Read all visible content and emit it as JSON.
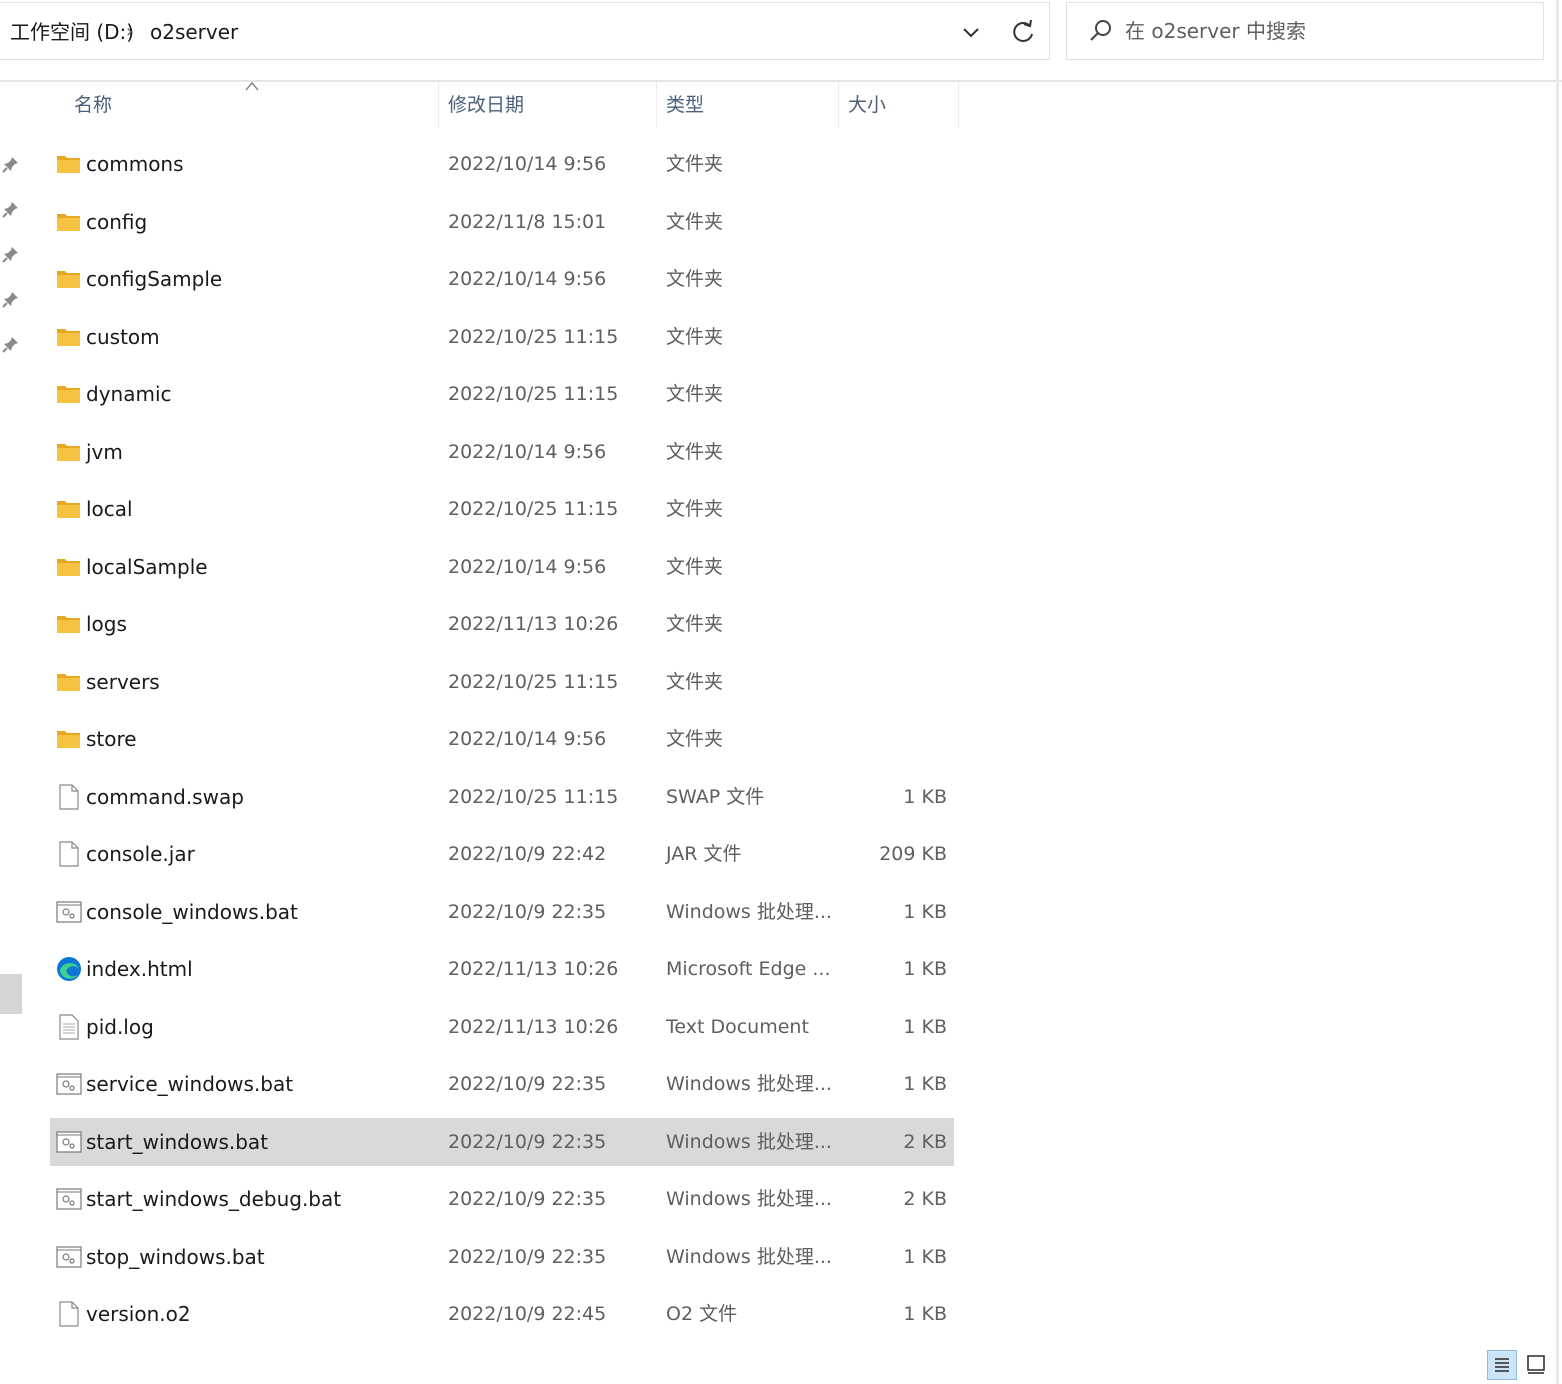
{
  "breadcrumb": {
    "drive": "工作空间 (D:)",
    "separator": "›",
    "folder": "o2server"
  },
  "search": {
    "placeholder": "在 o2server 中搜索"
  },
  "columns": {
    "name": "名称",
    "date": "修改日期",
    "type": "类型",
    "size": "大小"
  },
  "files": [
    {
      "name": "commons",
      "date": "2022/10/14 9:56",
      "type": "文件夹",
      "size": "",
      "icon": "folder-icon"
    },
    {
      "name": "config",
      "date": "2022/11/8 15:01",
      "type": "文件夹",
      "size": "",
      "icon": "folder-icon"
    },
    {
      "name": "configSample",
      "date": "2022/10/14 9:56",
      "type": "文件夹",
      "size": "",
      "icon": "folder-icon"
    },
    {
      "name": "custom",
      "date": "2022/10/25 11:15",
      "type": "文件夹",
      "size": "",
      "icon": "folder-icon"
    },
    {
      "name": "dynamic",
      "date": "2022/10/25 11:15",
      "type": "文件夹",
      "size": "",
      "icon": "folder-icon"
    },
    {
      "name": "jvm",
      "date": "2022/10/14 9:56",
      "type": "文件夹",
      "size": "",
      "icon": "folder-icon"
    },
    {
      "name": "local",
      "date": "2022/10/25 11:15",
      "type": "文件夹",
      "size": "",
      "icon": "folder-icon"
    },
    {
      "name": "localSample",
      "date": "2022/10/14 9:56",
      "type": "文件夹",
      "size": "",
      "icon": "folder-icon"
    },
    {
      "name": "logs",
      "date": "2022/11/13 10:26",
      "type": "文件夹",
      "size": "",
      "icon": "folder-icon"
    },
    {
      "name": "servers",
      "date": "2022/10/25 11:15",
      "type": "文件夹",
      "size": "",
      "icon": "folder-icon"
    },
    {
      "name": "store",
      "date": "2022/10/14 9:56",
      "type": "文件夹",
      "size": "",
      "icon": "folder-icon"
    },
    {
      "name": "command.swap",
      "date": "2022/10/25 11:15",
      "type": "SWAP 文件",
      "size": "1 KB",
      "icon": "file-icon"
    },
    {
      "name": "console.jar",
      "date": "2022/10/9 22:42",
      "type": "JAR 文件",
      "size": "209 KB",
      "icon": "file-icon"
    },
    {
      "name": "console_windows.bat",
      "date": "2022/10/9 22:35",
      "type": "Windows 批处理...",
      "size": "1 KB",
      "icon": "batch-file-icon"
    },
    {
      "name": "index.html",
      "date": "2022/11/13 10:26",
      "type": "Microsoft Edge ...",
      "size": "1 KB",
      "icon": "edge-icon"
    },
    {
      "name": "pid.log",
      "date": "2022/11/13 10:26",
      "type": "Text Document",
      "size": "1 KB",
      "icon": "text-file-icon"
    },
    {
      "name": "service_windows.bat",
      "date": "2022/10/9 22:35",
      "type": "Windows 批处理...",
      "size": "1 KB",
      "icon": "batch-file-icon"
    },
    {
      "name": "start_windows.bat",
      "date": "2022/10/9 22:35",
      "type": "Windows 批处理...",
      "size": "2 KB",
      "icon": "batch-file-icon",
      "selected": true
    },
    {
      "name": "start_windows_debug.bat",
      "date": "2022/10/9 22:35",
      "type": "Windows 批处理...",
      "size": "2 KB",
      "icon": "batch-file-icon"
    },
    {
      "name": "stop_windows.bat",
      "date": "2022/10/9 22:35",
      "type": "Windows 批处理...",
      "size": "1 KB",
      "icon": "batch-file-icon"
    },
    {
      "name": "version.o2",
      "date": "2022/10/9 22:45",
      "type": "O2 文件",
      "size": "1 KB",
      "icon": "file-icon"
    }
  ],
  "colors": {
    "selected_row": "#d9d9d9",
    "folder": "#f5c242",
    "header_text": "#4c607a",
    "edge_blue": "#0c77d6"
  }
}
